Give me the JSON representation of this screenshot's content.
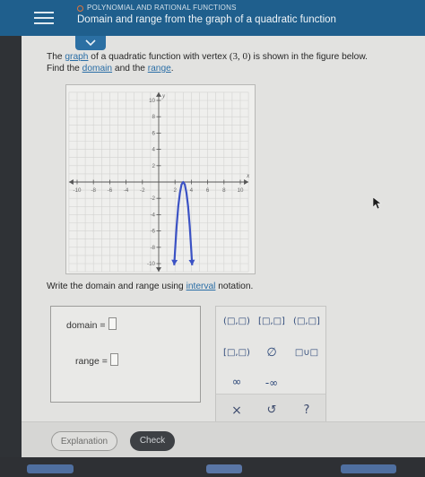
{
  "header": {
    "topic": "POLYNOMIAL AND RATIONAL FUNCTIONS",
    "title": "Domain and range from the graph of a quadratic function",
    "menu_icon": "hamburger-icon",
    "collapse_icon": "chevron-down-icon"
  },
  "question": {
    "part1": "The ",
    "graph_link": "graph",
    "part2": " of a quadratic function with vertex ",
    "vertex": "(3, 0)",
    "part3": " is shown in the figure below.",
    "part4": "Find the ",
    "domain_link": "domain",
    "part5": " and the ",
    "range_link": "range",
    "part6": "."
  },
  "chart_data": {
    "type": "line",
    "xlabel": "x",
    "ylabel": "y",
    "xlim": [
      -11,
      11
    ],
    "ylim": [
      -11,
      11
    ],
    "x_ticks": [
      -10,
      -8,
      -6,
      -4,
      -2,
      2,
      4,
      6,
      8,
      10
    ],
    "x_tick_labels": [
      "-10",
      "-8",
      "-6",
      "-4",
      "-2",
      "2",
      "4",
      "6",
      "8",
      "10"
    ],
    "y_ticks": [
      10,
      8,
      6,
      4,
      2,
      -2,
      -4,
      -6,
      -8,
      -10
    ],
    "y_tick_labels": [
      "10",
      "8",
      "6",
      "4",
      "2",
      "-2",
      "-4",
      "-6",
      "-8",
      "-10"
    ],
    "grid": true,
    "series": [
      {
        "color": "#3b52c4",
        "arrows": "both-ends-down",
        "x": [
          1.9,
          2.0,
          2.2,
          2.4,
          2.6,
          2.8,
          3.0,
          3.2,
          3.4,
          3.6,
          3.8,
          4.0,
          4.1
        ],
        "y": [
          -10.2,
          -8.5,
          -5.4,
          -3.0,
          -1.3,
          -0.3,
          0,
          -0.3,
          -1.3,
          -3.0,
          -5.4,
          -8.5,
          -10.2
        ]
      }
    ]
  },
  "instruction": {
    "part1": "Write the domain and range using ",
    "interval_link": "interval",
    "part2": " notation."
  },
  "answers": {
    "domain_label": "domain =",
    "range_label": "range ="
  },
  "palette": {
    "open_open": "(□,□)",
    "closed_closed": "[□,□]",
    "open_closed": "(□,□]",
    "closed_open": "[□,□)",
    "empty_set": "∅",
    "union": "□∪□",
    "infinity": "∞",
    "neg_infinity": "-∞",
    "clear": "×",
    "undo": "↺",
    "help": "?"
  },
  "buttons": {
    "explanation": "Explanation",
    "check": "Check"
  },
  "colors": {
    "header_bg": "#1f5f8d",
    "link": "#2a6ea6",
    "curve": "#3b52c4",
    "check_button": "#3d4044"
  }
}
